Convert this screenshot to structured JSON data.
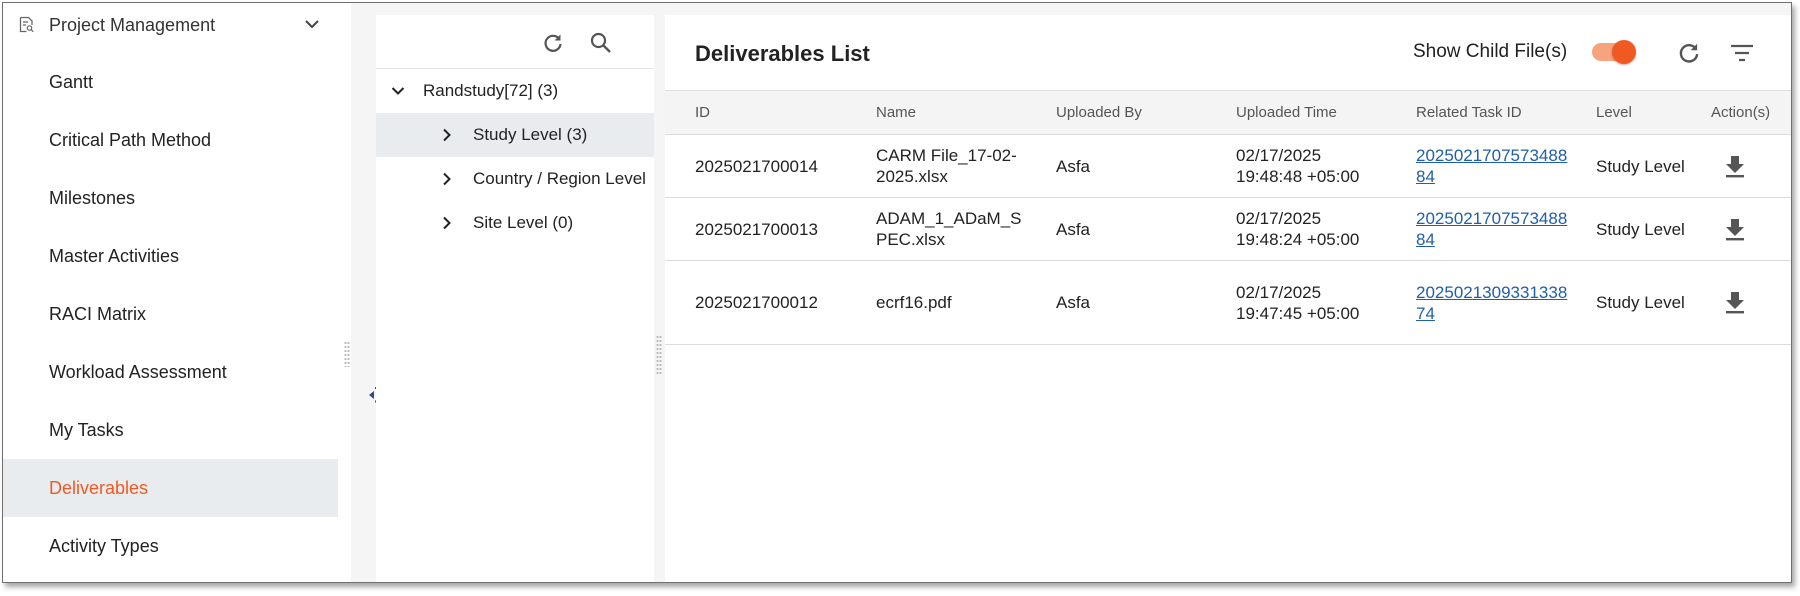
{
  "nav": {
    "section_title": "Project Management",
    "items": [
      {
        "label": "Gantt"
      },
      {
        "label": "Critical Path Method"
      },
      {
        "label": "Milestones"
      },
      {
        "label": "Master Activities"
      },
      {
        "label": "RACI Matrix"
      },
      {
        "label": "Workload Assessment"
      },
      {
        "label": "My Tasks"
      },
      {
        "label": "Deliverables",
        "active": true
      },
      {
        "label": "Activity Types"
      }
    ]
  },
  "tree": {
    "root": {
      "label": "Randstudy[72] (3)"
    },
    "children": [
      {
        "label": "Study Level (3)",
        "selected": true
      },
      {
        "label": "Country / Region Level"
      },
      {
        "label": "Site Level (0)"
      }
    ]
  },
  "main": {
    "title": "Deliverables List",
    "show_child_label": "Show Child File(s)",
    "show_child_on": true,
    "columns": [
      "ID",
      "Name",
      "Uploaded By",
      "Uploaded Time",
      "Related Task ID",
      "Level",
      "Action(s)"
    ],
    "rows": [
      {
        "id": "2025021700014",
        "name": "CARM File_17-02-2025.xlsx",
        "uploaded_by": "Asfa",
        "uploaded_time": "02/17/2025 19:48:48 +05:00",
        "task_id": "202502170757348884",
        "level": "Study Level"
      },
      {
        "id": "2025021700013",
        "name": "ADAM_1_ADaM_SPEC.xlsx",
        "uploaded_by": "Asfa",
        "uploaded_time": "02/17/2025 19:48:24 +05:00",
        "task_id": "202502170757348884",
        "level": "Study Level"
      },
      {
        "id": "2025021700012",
        "name": "ecrf16.pdf",
        "uploaded_by": "Asfa",
        "uploaded_time": "02/17/2025 19:47:45 +05:00",
        "task_id": "202502130933133874",
        "level": "Study Level"
      }
    ]
  },
  "colors": {
    "accent": "#f05a22",
    "link": "#1f5fa8",
    "selected_bg": "#e9ecef"
  },
  "icons": [
    "document-search-icon",
    "chevron-down-icon",
    "refresh-icon",
    "search-icon",
    "chevron-right-icon",
    "collapse-panel-icon",
    "filter-icon",
    "download-icon"
  ]
}
